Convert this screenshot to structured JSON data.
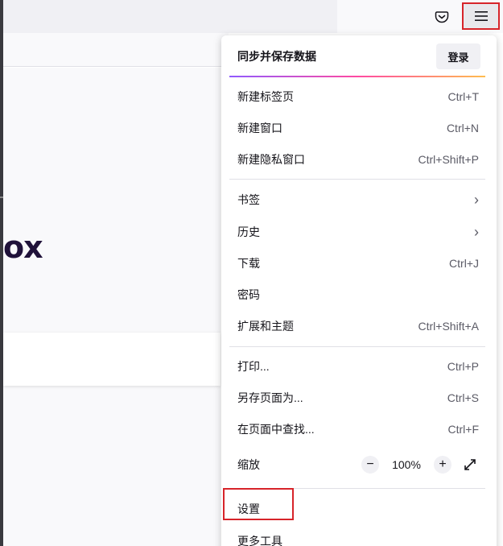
{
  "toolbar": {
    "pocket_icon": "pocket-icon",
    "menu_icon": "hamburger-menu-icon"
  },
  "page": {
    "brand_text": "ox"
  },
  "menu": {
    "sync": {
      "title": "同步并保存数据",
      "login": "登录"
    },
    "items": [
      {
        "label": "新建标签页",
        "shortcut": "Ctrl+T"
      },
      {
        "label": "新建窗口",
        "shortcut": "Ctrl+N"
      },
      {
        "label": "新建隐私窗口",
        "shortcut": "Ctrl+Shift+P"
      },
      {
        "label": "书签",
        "shortcut": ""
      },
      {
        "label": "历史",
        "shortcut": ""
      },
      {
        "label": "下载",
        "shortcut": "Ctrl+J"
      },
      {
        "label": "密码",
        "shortcut": ""
      },
      {
        "label": "扩展和主题",
        "shortcut": "Ctrl+Shift+A"
      },
      {
        "label": "打印...",
        "shortcut": "Ctrl+P"
      },
      {
        "label": "另存页面为...",
        "shortcut": "Ctrl+S"
      },
      {
        "label": "在页面中查找...",
        "shortcut": "Ctrl+F"
      },
      {
        "label": "缩放",
        "shortcut": ""
      },
      {
        "label": "设置",
        "shortcut": ""
      },
      {
        "label": "更多工具",
        "shortcut": ""
      }
    ],
    "zoom": {
      "minus": "−",
      "value": "100%",
      "plus": "+"
    },
    "chevron": "›"
  },
  "colors": {
    "highlight": "#d7242a",
    "gradient": [
      "#9059ff",
      "#ff4aa2",
      "#ffbd4f"
    ]
  }
}
